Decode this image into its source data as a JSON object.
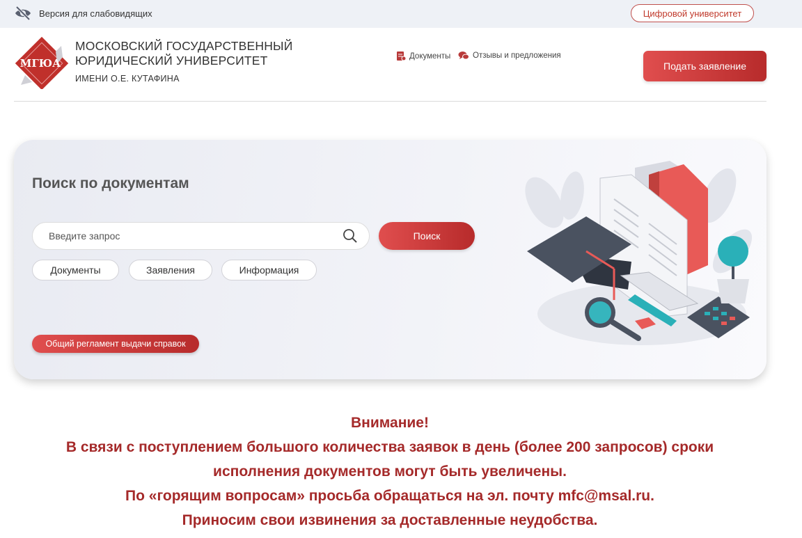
{
  "topbar": {
    "vision_label": "Версия для слабовидящих",
    "digital_university": "Цифровой университет"
  },
  "header": {
    "logo_text": "МГЮА",
    "title_line1": "МОСКОВСКИЙ ГОСУДАРСТВЕННЫЙ",
    "title_line2": "ЮРИДИЧЕСКИЙ УНИВЕРСИТЕТ",
    "title_line3": "ИМЕНИ О.Е. КУТАФИНА",
    "nav": {
      "documents": "Документы",
      "reviews": "Отзывы и предложения"
    },
    "apply_button": "Подать заявление"
  },
  "search_card": {
    "title": "Поиск по документам",
    "placeholder": "Введите запрос",
    "search_button": "Поиск",
    "filters": [
      "Документы",
      "Заявления",
      "Информация"
    ],
    "regulation_button": "Общий регламент выдачи справок"
  },
  "notice": {
    "lines": [
      "Внимание!",
      "В связи с поступлением большого количества заявок в день (более 200 запросов) сроки",
      "исполнения документов могут быть увеличены.",
      "По «горящим вопросам» просьба обращаться на эл. почту mfc@msal.ru.",
      "Приносим свои извинения за доставленные неудобства."
    ]
  },
  "colors": {
    "accent": "#c0392b",
    "accent_gradient_start": "#e04e4e",
    "accent_gradient_end": "#b72b2b",
    "topbar_bg": "#eef1f6",
    "notice_text": "#a52a2a"
  },
  "icons": {
    "vision": "eye-crossed-icon",
    "documents": "document-icon",
    "reviews": "chat-bubbles-icon",
    "search": "magnifier-icon"
  }
}
